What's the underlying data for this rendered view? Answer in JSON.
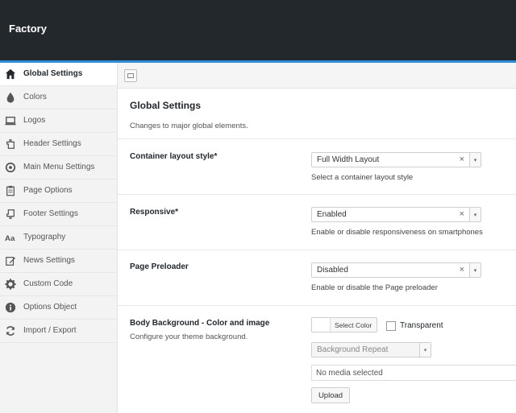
{
  "app": {
    "title": "Factory"
  },
  "sidebar": {
    "items": [
      {
        "label": "Global Settings",
        "icon": "home-icon",
        "active": true
      },
      {
        "label": "Colors",
        "icon": "droplet-icon"
      },
      {
        "label": "Logos",
        "icon": "laptop-icon"
      },
      {
        "label": "Header Settings",
        "icon": "hand-up-icon"
      },
      {
        "label": "Main Menu Settings",
        "icon": "circle-dot-icon"
      },
      {
        "label": "Page Options",
        "icon": "clipboard-icon"
      },
      {
        "label": "Footer Settings",
        "icon": "hand-down-icon"
      },
      {
        "label": "Typography",
        "icon": "font-icon"
      },
      {
        "label": "News Settings",
        "icon": "edit-icon"
      },
      {
        "label": "Custom Code",
        "icon": "gear-icon"
      },
      {
        "label": "Options Object",
        "icon": "info-icon"
      },
      {
        "label": "Import / Export",
        "icon": "refresh-icon"
      }
    ]
  },
  "main": {
    "title": "Global Settings",
    "description": "Changes to major global elements.",
    "fields": {
      "container": {
        "label": "Container layout style*",
        "value": "Full Width Layout",
        "help": "Select a container layout style"
      },
      "responsive": {
        "label": "Responsive*",
        "value": "Enabled",
        "help": "Enable or disable responsiveness on smartphones"
      },
      "preloader": {
        "label": "Page Preloader",
        "value": "Disabled",
        "help": "Enable or disable the Page preloader"
      },
      "background": {
        "label": "Body Background - Color and image",
        "sub": "Configure your theme background.",
        "color_button": "Select Color",
        "transparent_label": "Transparent",
        "repeat_placeholder": "Background Repeat",
        "media_value": "No media selected",
        "upload_label": "Upload"
      }
    },
    "clear_glyph": "×",
    "arrow_glyph": "▾"
  },
  "colors": {
    "topbar": "#23282d",
    "accent": "#2e8fd8"
  }
}
